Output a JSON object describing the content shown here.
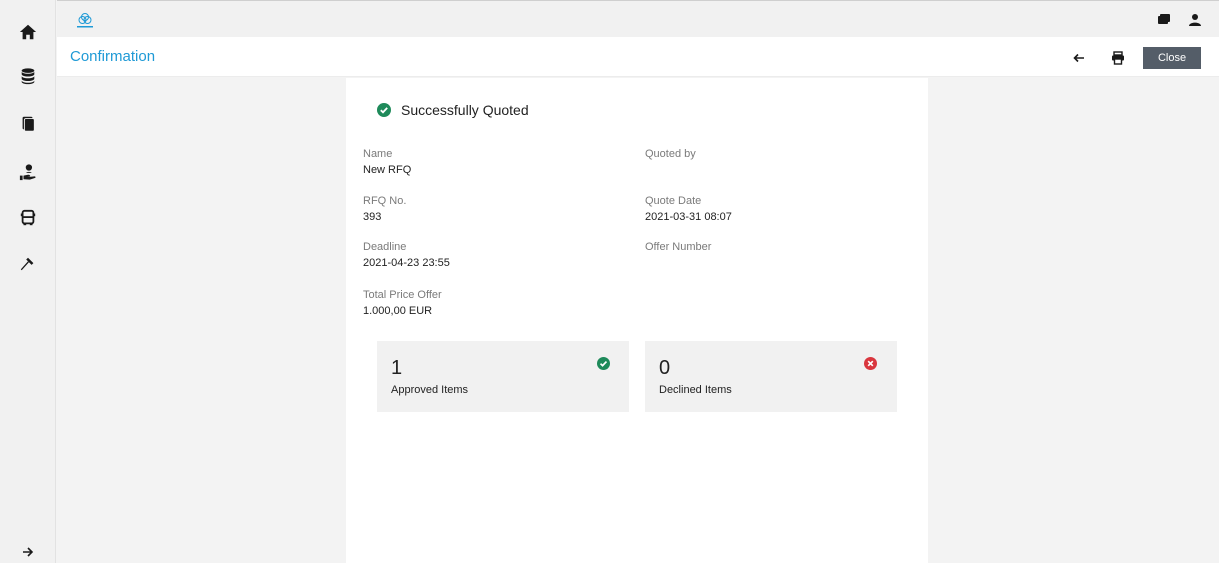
{
  "header": {
    "title": "Confirmation",
    "close_label": "Close"
  },
  "confirmation": {
    "status": "Successfully Quoted",
    "fields": {
      "name": {
        "label": "Name",
        "value": "New RFQ"
      },
      "rfq_no": {
        "label": "RFQ No.",
        "value": "393"
      },
      "deadline": {
        "label": "Deadline",
        "value": "2021-04-23 23:55"
      },
      "total_price": {
        "label": "Total Price Offer",
        "value": "1.000,00 EUR"
      },
      "quoted_by": {
        "label": "Quoted by",
        "value": ""
      },
      "quote_date": {
        "label": "Quote Date",
        "value": "2021-03-31 08:07"
      },
      "offer_number": {
        "label": "Offer Number",
        "value": ""
      }
    },
    "stats": {
      "approved": {
        "count": "1",
        "label": "Approved Items"
      },
      "declined": {
        "count": "0",
        "label": "Declined Items"
      }
    }
  },
  "icons": {
    "rail": [
      "home-icon",
      "database-icon",
      "documents-icon",
      "hand-person-icon",
      "bus-icon",
      "hammer-icon",
      "arrow-right-icon"
    ],
    "top": [
      "chat-icon",
      "user-icon"
    ],
    "header": [
      "back-arrow-icon",
      "print-icon"
    ]
  },
  "colors": {
    "accent": "#1f9ad6",
    "success": "#1e8a5a",
    "error": "#d9363e",
    "close_button": "#545d68"
  }
}
